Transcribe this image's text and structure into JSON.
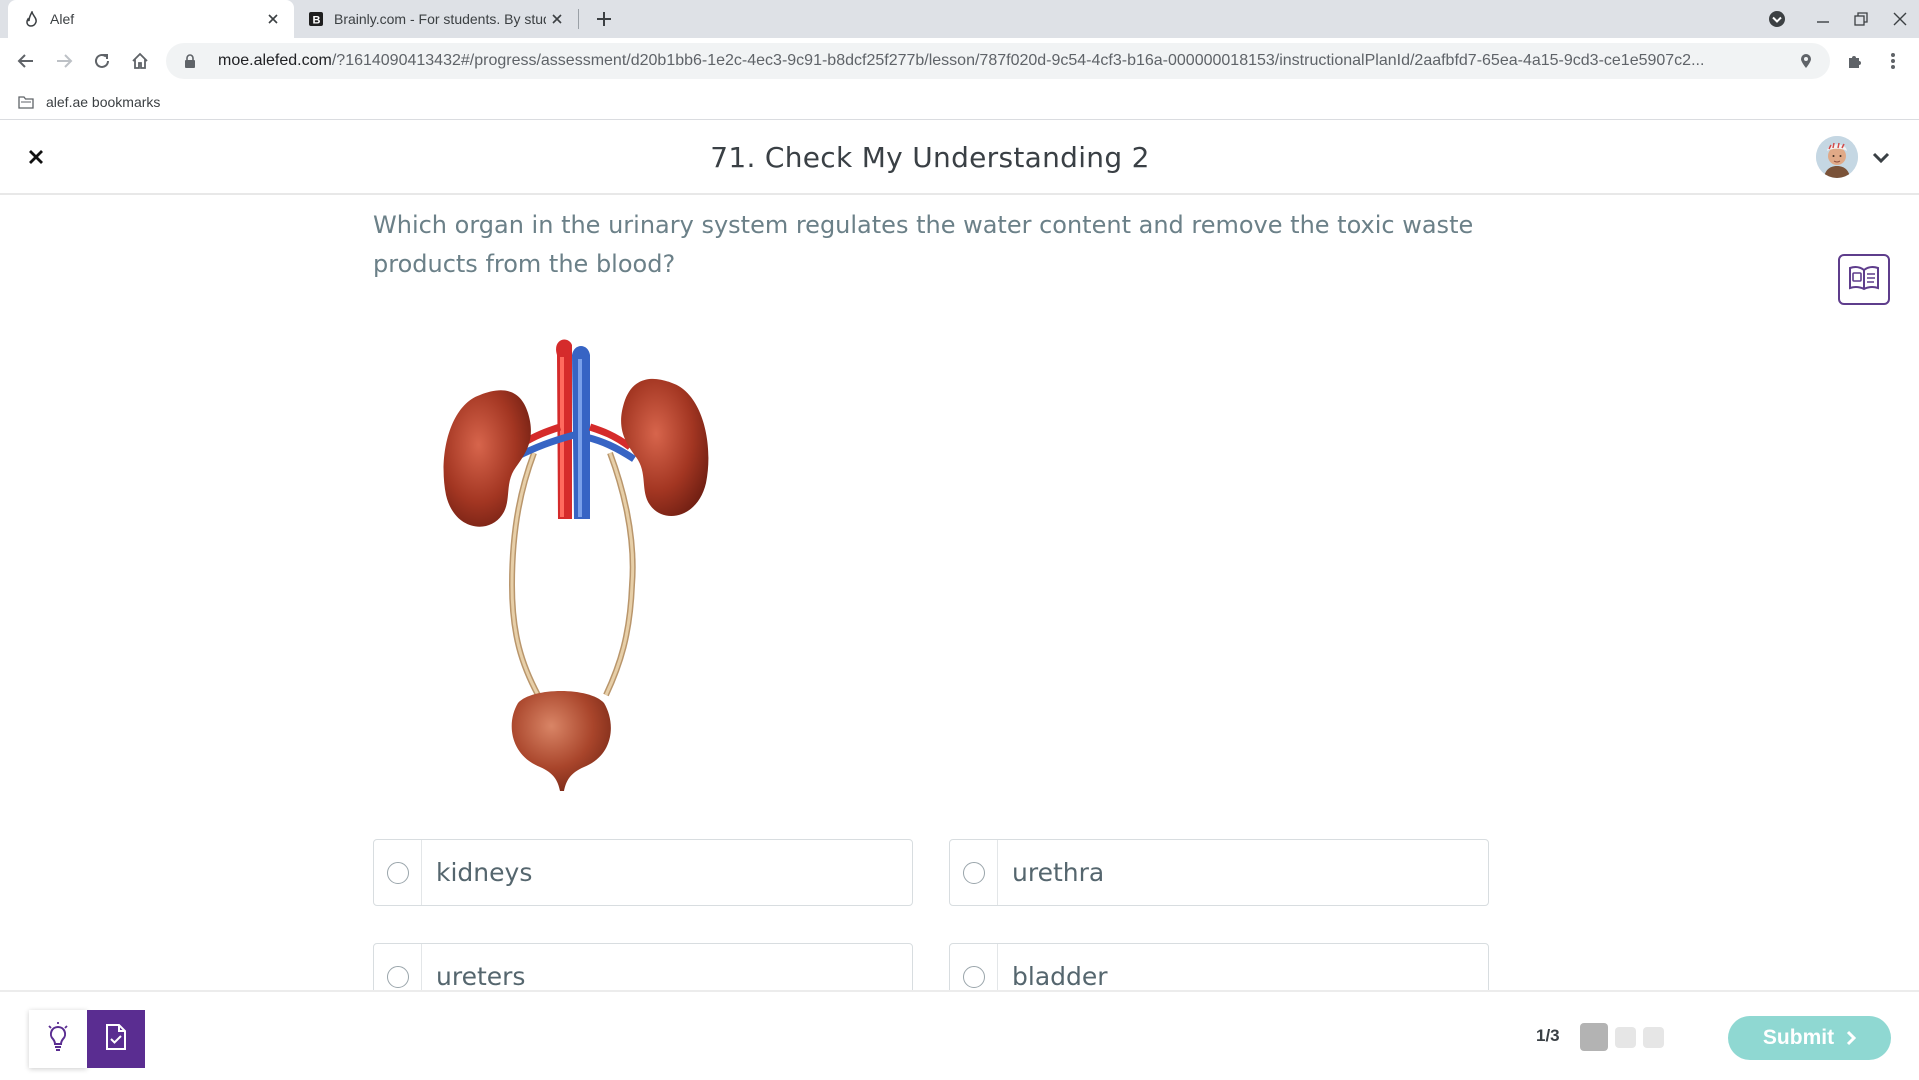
{
  "browser": {
    "tabs": [
      {
        "title": "Alef",
        "active": true
      },
      {
        "title": "Brainly.com - For students. By students.",
        "active": false
      }
    ],
    "url_host": "moe.alefed.com",
    "url_path": "/?1614090413432#/progress/assessment/d20b1bb6-1e2c-4ec3-9c91-b8dcf25f277b/lesson/787f020d-9c54-4cf3-b16a-000000018153/instructionalPlanId/2aafbfd7-65ea-4a15-9cd3-ce1e5907c2...",
    "bookmark_folder": "alef.ae bookmarks"
  },
  "app": {
    "title": "71. Check My Understanding 2"
  },
  "question": {
    "text": "Which organ in the urinary system regulates the water content and remove the toxic waste products from the blood?",
    "options": [
      {
        "label": "kidneys"
      },
      {
        "label": "urethra"
      },
      {
        "label": "ureters"
      },
      {
        "label": "bladder"
      }
    ]
  },
  "footer": {
    "page_indicator": "1/3",
    "submit_label": "Submit"
  },
  "colors": {
    "brand_purple": "#5a2d91",
    "submit_teal": "#8fd8d2",
    "question_text": "#6b8088"
  },
  "icons": [
    "close-icon",
    "avatar",
    "chevron-down-icon",
    "glossary-book-icon",
    "lightbulb-hint-icon",
    "notes-document-icon",
    "chevron-right-icon"
  ]
}
